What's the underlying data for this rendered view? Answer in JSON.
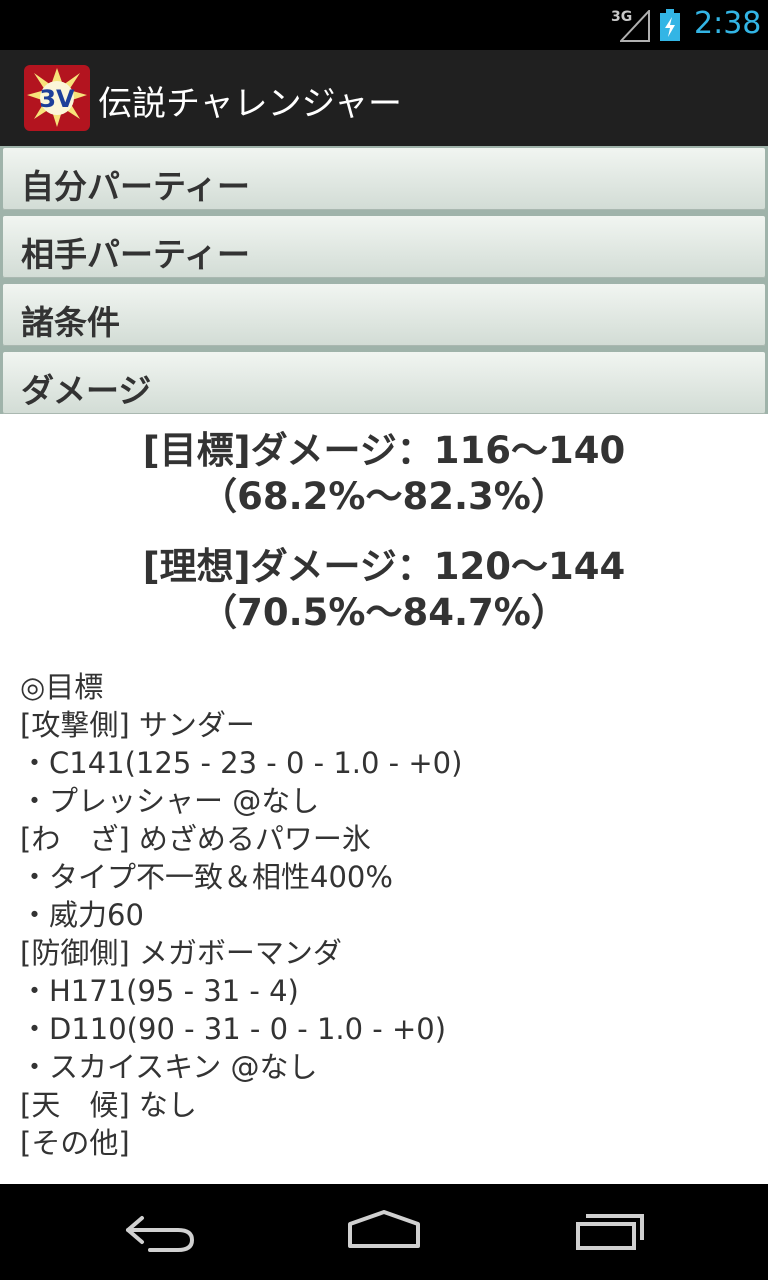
{
  "status_bar": {
    "network": "3G",
    "time": "2:38"
  },
  "app": {
    "title": "伝説チャレンジャー",
    "icon_text": "3V"
  },
  "sections": [
    {
      "label": "自分パーティー"
    },
    {
      "label": "相手パーティー"
    },
    {
      "label": "諸条件"
    },
    {
      "label": "ダメージ"
    }
  ],
  "results": [
    {
      "line1": "[目標]ダメージ：116〜140",
      "line2": "（68.2%〜82.3%）"
    },
    {
      "line1": "[理想]ダメージ：120〜144",
      "line2": "（70.5%〜84.7%）"
    }
  ],
  "detail_lines": [
    "◎目標",
    "[攻撃側] サンダー",
    "・C141(125 - 23 - 0 - 1.0 - +0)",
    "・プレッシャー @なし",
    "[わ　ざ] めざめるパワー氷",
    "・タイプ不一致＆相性400%",
    "・威力60",
    "[防御側] メガボーマンダ",
    "・H171(95 - 31 - 4)",
    "・D110(90 - 31 - 0 - 1.0 - +0)",
    "・スカイスキン @なし",
    "[天　候] なし",
    "[その他]"
  ],
  "colors": {
    "clock": "#33b5e5",
    "action_bar": "#202020",
    "section_button": "#dde5df"
  }
}
